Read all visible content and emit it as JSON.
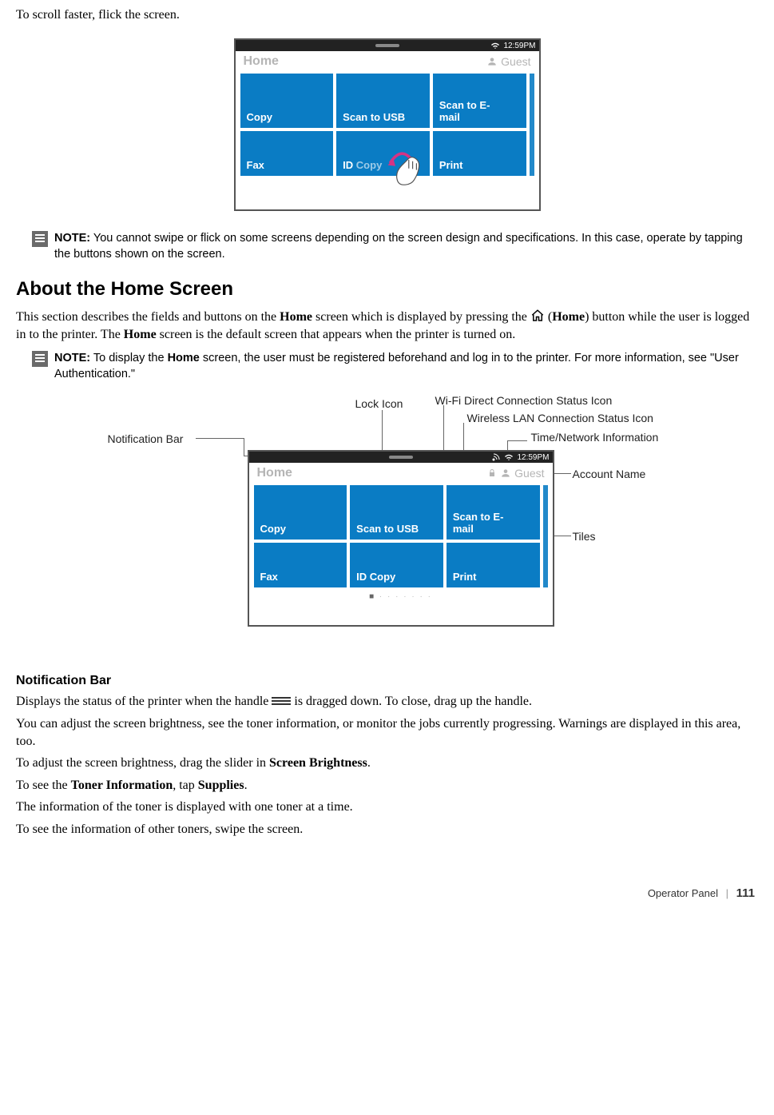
{
  "intro": "To scroll faster, flick the screen.",
  "screen1": {
    "time": "12:59PM",
    "title": "Home",
    "account": "Guest",
    "tiles": {
      "copy": "Copy",
      "scan_usb": "Scan to USB",
      "scan_email": "Scan to E-\nmail",
      "fax": "Fax",
      "id_copy": "ID Copy",
      "print": "Print"
    }
  },
  "note1": {
    "prefix": "NOTE:",
    "body": " You cannot swipe or flick on some screens depending on the screen design and specifications. In this case, operate by tapping the buttons shown on the screen."
  },
  "heading_about": "About the Home Screen",
  "about_para_a": "This section describes the fields and buttons on the ",
  "about_para_home1": "Home",
  "about_para_b": " screen which is displayed by pressing the ",
  "about_para_home2_open": " (",
  "about_para_home2": "Home",
  "about_para_home2_close": ") button while the user is logged in to the printer. The ",
  "about_para_home3": "Home",
  "about_para_c": " screen is the default screen that appears when the printer is turned on.",
  "note2": {
    "prefix": "NOTE:",
    "body_a": " To display the ",
    "body_home": "Home",
    "body_b": " screen, the user must be registered beforehand and log in to the printer. For more information, see \"User Authentication.\""
  },
  "labels": {
    "lock": "Lock Icon",
    "wifi_direct": "Wi-Fi Direct Connection Status Icon",
    "wlan": "Wireless LAN Connection Status Icon",
    "time_net": "Time/Network Information",
    "account": "Account Name",
    "tiles": "Tiles",
    "notif": "Notification Bar"
  },
  "screen2": {
    "time": "12:59PM",
    "title": "Home",
    "account": "Guest",
    "tiles": {
      "copy": "Copy",
      "scan_usb": "Scan to USB",
      "scan_email": "Scan to E-\nmail",
      "fax": "Fax",
      "id_copy": "ID Copy",
      "print": "Print"
    }
  },
  "heading_notif": "Notification Bar",
  "notif_p1_a": "Displays the status of the printer when the handle ",
  "notif_p1_b": " is dragged down. To close, drag up the handle.",
  "notif_p2": "You can adjust the screen brightness, see the toner information, or monitor the jobs currently progressing. Warnings are displayed in this area, too.",
  "notif_p3_a": "To adjust the screen brightness, drag the slider in ",
  "notif_p3_b": "Screen Brightness",
  "notif_p3_c": ".",
  "notif_p4_a": "To see the ",
  "notif_p4_b": "Toner Information",
  "notif_p4_c": ", tap ",
  "notif_p4_d": "Supplies",
  "notif_p4_e": ".",
  "notif_p5": "The information of the toner is displayed with one toner at a time.",
  "notif_p6": "To see the information of other toners, swipe the screen.",
  "footer": {
    "section": "Operator Panel",
    "page": "111"
  }
}
